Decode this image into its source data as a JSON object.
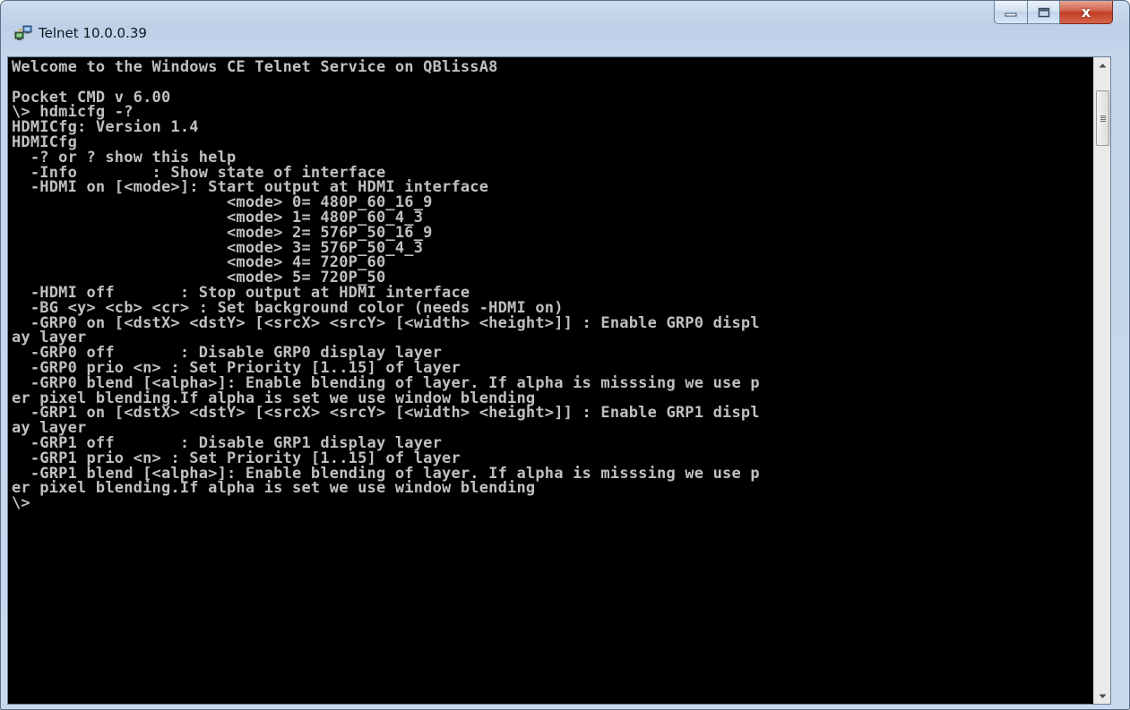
{
  "window": {
    "title": "Telnet 10.0.0.39",
    "icon": "telnet-computer-icon",
    "close_glyph": "x"
  },
  "caption_buttons": {
    "minimize_icon": "minimize-icon",
    "maximize_icon": "maximize-icon",
    "close_icon": "close-icon"
  },
  "console": {
    "background": "#000000",
    "foreground": "#c0c0c0",
    "lines": [
      "Welcome to the Windows CE Telnet Service on QBlissA8",
      "",
      "Pocket CMD v 6.00",
      "\\> hdmicfg -?",
      "HDMICfg: Version 1.4",
      "HDMICfg",
      "  -? or ? show this help",
      "  -Info        : Show state of interface",
      "  -HDMI on [<mode>]: Start output at HDMI interface",
      "                       <mode> 0= 480P_60_16_9",
      "                       <mode> 1= 480P_60_4_3",
      "                       <mode> 2= 576P_50_16_9",
      "                       <mode> 3= 576P_50_4_3",
      "                       <mode> 4= 720P_60",
      "                       <mode> 5= 720P_50",
      "  -HDMI off       : Stop output at HDMI interface",
      "  -BG <y> <cb> <cr> : Set background color (needs -HDMI on)",
      "  -GRP0 on [<dstX> <dstY> [<srcX> <srcY> [<width> <height>]] : Enable GRP0 displ",
      "ay layer",
      "  -GRP0 off       : Disable GRP0 display layer",
      "  -GRP0 prio <n> : Set Priority [1..15] of layer",
      "  -GRP0 blend [<alpha>]: Enable blending of layer. If alpha is misssing we use p",
      "er pixel blending.If alpha is set we use window blending",
      "  -GRP1 on [<dstX> <dstY> [<srcX> <srcY> [<width> <height>]] : Enable GRP1 displ",
      "ay layer",
      "  -GRP1 off       : Disable GRP1 display layer",
      "  -GRP1 prio <n> : Set Priority [1..15] of layer",
      "  -GRP1 blend [<alpha>]: Enable blending of layer. If alpha is misssing we use p",
      "er pixel blending.If alpha is set we use window blending",
      "\\>"
    ]
  },
  "scrollbar": {
    "up_icon": "scroll-up-arrow-icon",
    "down_icon": "scroll-down-arrow-icon",
    "thumb_icon": "scroll-thumb-grip-icon"
  }
}
